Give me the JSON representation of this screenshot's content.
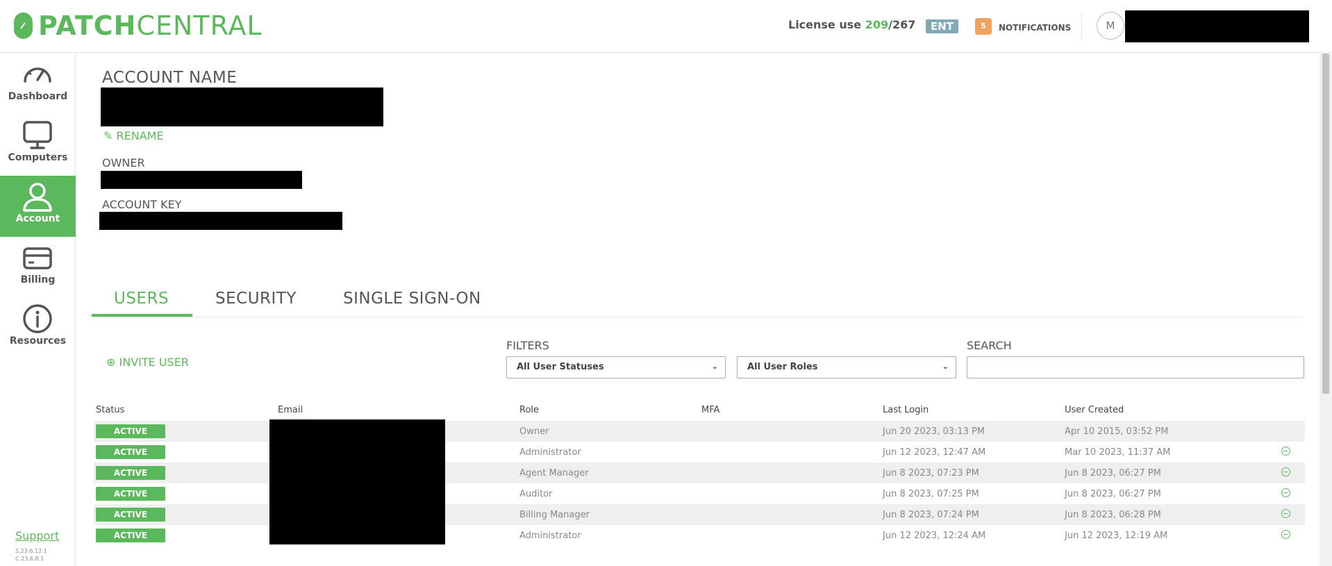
{
  "header": {
    "logo_bold": "PATCH",
    "logo_light": "CENTRAL",
    "license_label": "License use",
    "license_used": "209",
    "license_sep": "/",
    "license_total": "267",
    "plan_badge": "ENT",
    "notifications_count": "5",
    "notifications_label": "NOTIFICATIONS",
    "avatar_initial": "M"
  },
  "sidebar": {
    "items": [
      {
        "label": "Dashboard",
        "icon": "gauge-icon"
      },
      {
        "label": "Computers",
        "icon": "monitor-icon"
      },
      {
        "label": "Account",
        "icon": "user-icon",
        "active": true
      },
      {
        "label": "Billing",
        "icon": "credit-card-icon"
      },
      {
        "label": "Resources",
        "icon": "info-icon"
      }
    ],
    "support_label": "Support",
    "version_server": "S.23.6.12.1",
    "version_client": "C.23.6.8.1"
  },
  "account": {
    "title": "ACCOUNT NAME",
    "rename_label": "RENAME",
    "owner_label": "OWNER",
    "key_label": "ACCOUNT KEY"
  },
  "tabs": [
    "USERS",
    "SECURITY",
    "SINGLE SIGN-ON"
  ],
  "users": {
    "invite_label": "INVITE USER",
    "filters_label": "FILTERS",
    "status_filter": "All User Statuses",
    "role_filter": "All User Roles",
    "search_label": "SEARCH",
    "columns": [
      "Status",
      "Email",
      "Role",
      "MFA",
      "Last Login",
      "User Created"
    ],
    "rows": [
      {
        "status": "ACTIVE",
        "role": "Owner",
        "mfa": "",
        "last_login": "Jun 20 2023, 03:13 PM",
        "created": "Apr 10 2015, 03:52 PM"
      },
      {
        "status": "ACTIVE",
        "role": "Administrator",
        "mfa": "",
        "last_login": "Jun 12 2023, 12:47 AM",
        "created": "Mar 10 2023, 11:37 AM"
      },
      {
        "status": "ACTIVE",
        "role": "Agent Manager",
        "mfa": "",
        "last_login": "Jun 8 2023, 07:23 PM",
        "created": "Jun 8 2023, 06:27 PM"
      },
      {
        "status": "ACTIVE",
        "role": "Auditor",
        "mfa": "",
        "last_login": "Jun 8 2023, 07:25 PM",
        "created": "Jun 8 2023, 06:27 PM"
      },
      {
        "status": "ACTIVE",
        "role": "Billing Manager",
        "mfa": "",
        "last_login": "Jun 8 2023, 07:24 PM",
        "created": "Jun 8 2023, 06:28 PM"
      },
      {
        "status": "ACTIVE",
        "role": "Administrator",
        "mfa": "",
        "last_login": "Jun 12 2023, 12:24 AM",
        "created": "Jun 12 2023, 12:19 AM"
      }
    ]
  },
  "colors": {
    "accent": "#5cb85c",
    "ent_badge": "#7fa9b5",
    "notification_badge": "#f0a35e"
  }
}
